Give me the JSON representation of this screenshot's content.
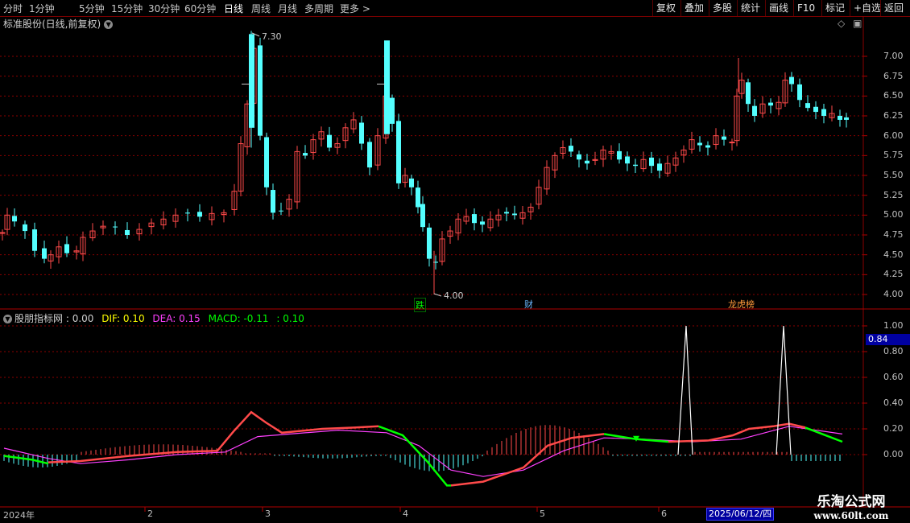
{
  "toolbar": {
    "periods": [
      "分时",
      "1分钟",
      "5分钟",
      "15分钟",
      "30分钟",
      "60分钟",
      "日线",
      "周线",
      "月线",
      "多周期",
      "更多 >"
    ],
    "active_period": "日线",
    "right_buttons": [
      "复权",
      "叠加",
      "多股",
      "统计",
      "画线",
      "F10",
      "标记",
      "+自选",
      "返回"
    ]
  },
  "stock": {
    "title": "标准股份(日线,前复权)",
    "high_label": "7.30",
    "low_label": "4.00",
    "events": [
      {
        "label": "跌",
        "color": "#00ff00"
      },
      {
        "label": "财",
        "color": "#6ab7ff"
      },
      {
        "label": "龙虎榜",
        "color": "#ff9a3a"
      }
    ]
  },
  "price_axis": [
    "7.00",
    "6.75",
    "6.50",
    "6.25",
    "6.00",
    "5.75",
    "5.50",
    "5.25",
    "5.00",
    "4.75",
    "4.50",
    "4.25",
    "4.00"
  ],
  "indicator": {
    "name": "股朋指标网",
    "name_value": ": 0.00",
    "dif": "DIF: 0.10",
    "dea": "DEA: 0.15",
    "macd": "MACD: -0.11",
    "extra": ": 0.10",
    "axis": [
      "1.00",
      "0.80",
      "0.60",
      "0.40",
      "0.20",
      "0.00"
    ],
    "cursor_value": "0.84"
  },
  "time_axis": {
    "labels": [
      "2024年",
      "2",
      "3",
      "4",
      "5",
      "6"
    ],
    "cursor_date": "2025/06/12/四"
  },
  "watermark": {
    "line1": "乐淘公式网",
    "line2": "www.60lt.com"
  },
  "colors": {
    "up": "#ff4a4a",
    "down": "#54ffff",
    "dif": "#ffff00",
    "dea": "#ff40ff",
    "macd_green": "#00ff00",
    "grid": "#8a0000"
  }
}
